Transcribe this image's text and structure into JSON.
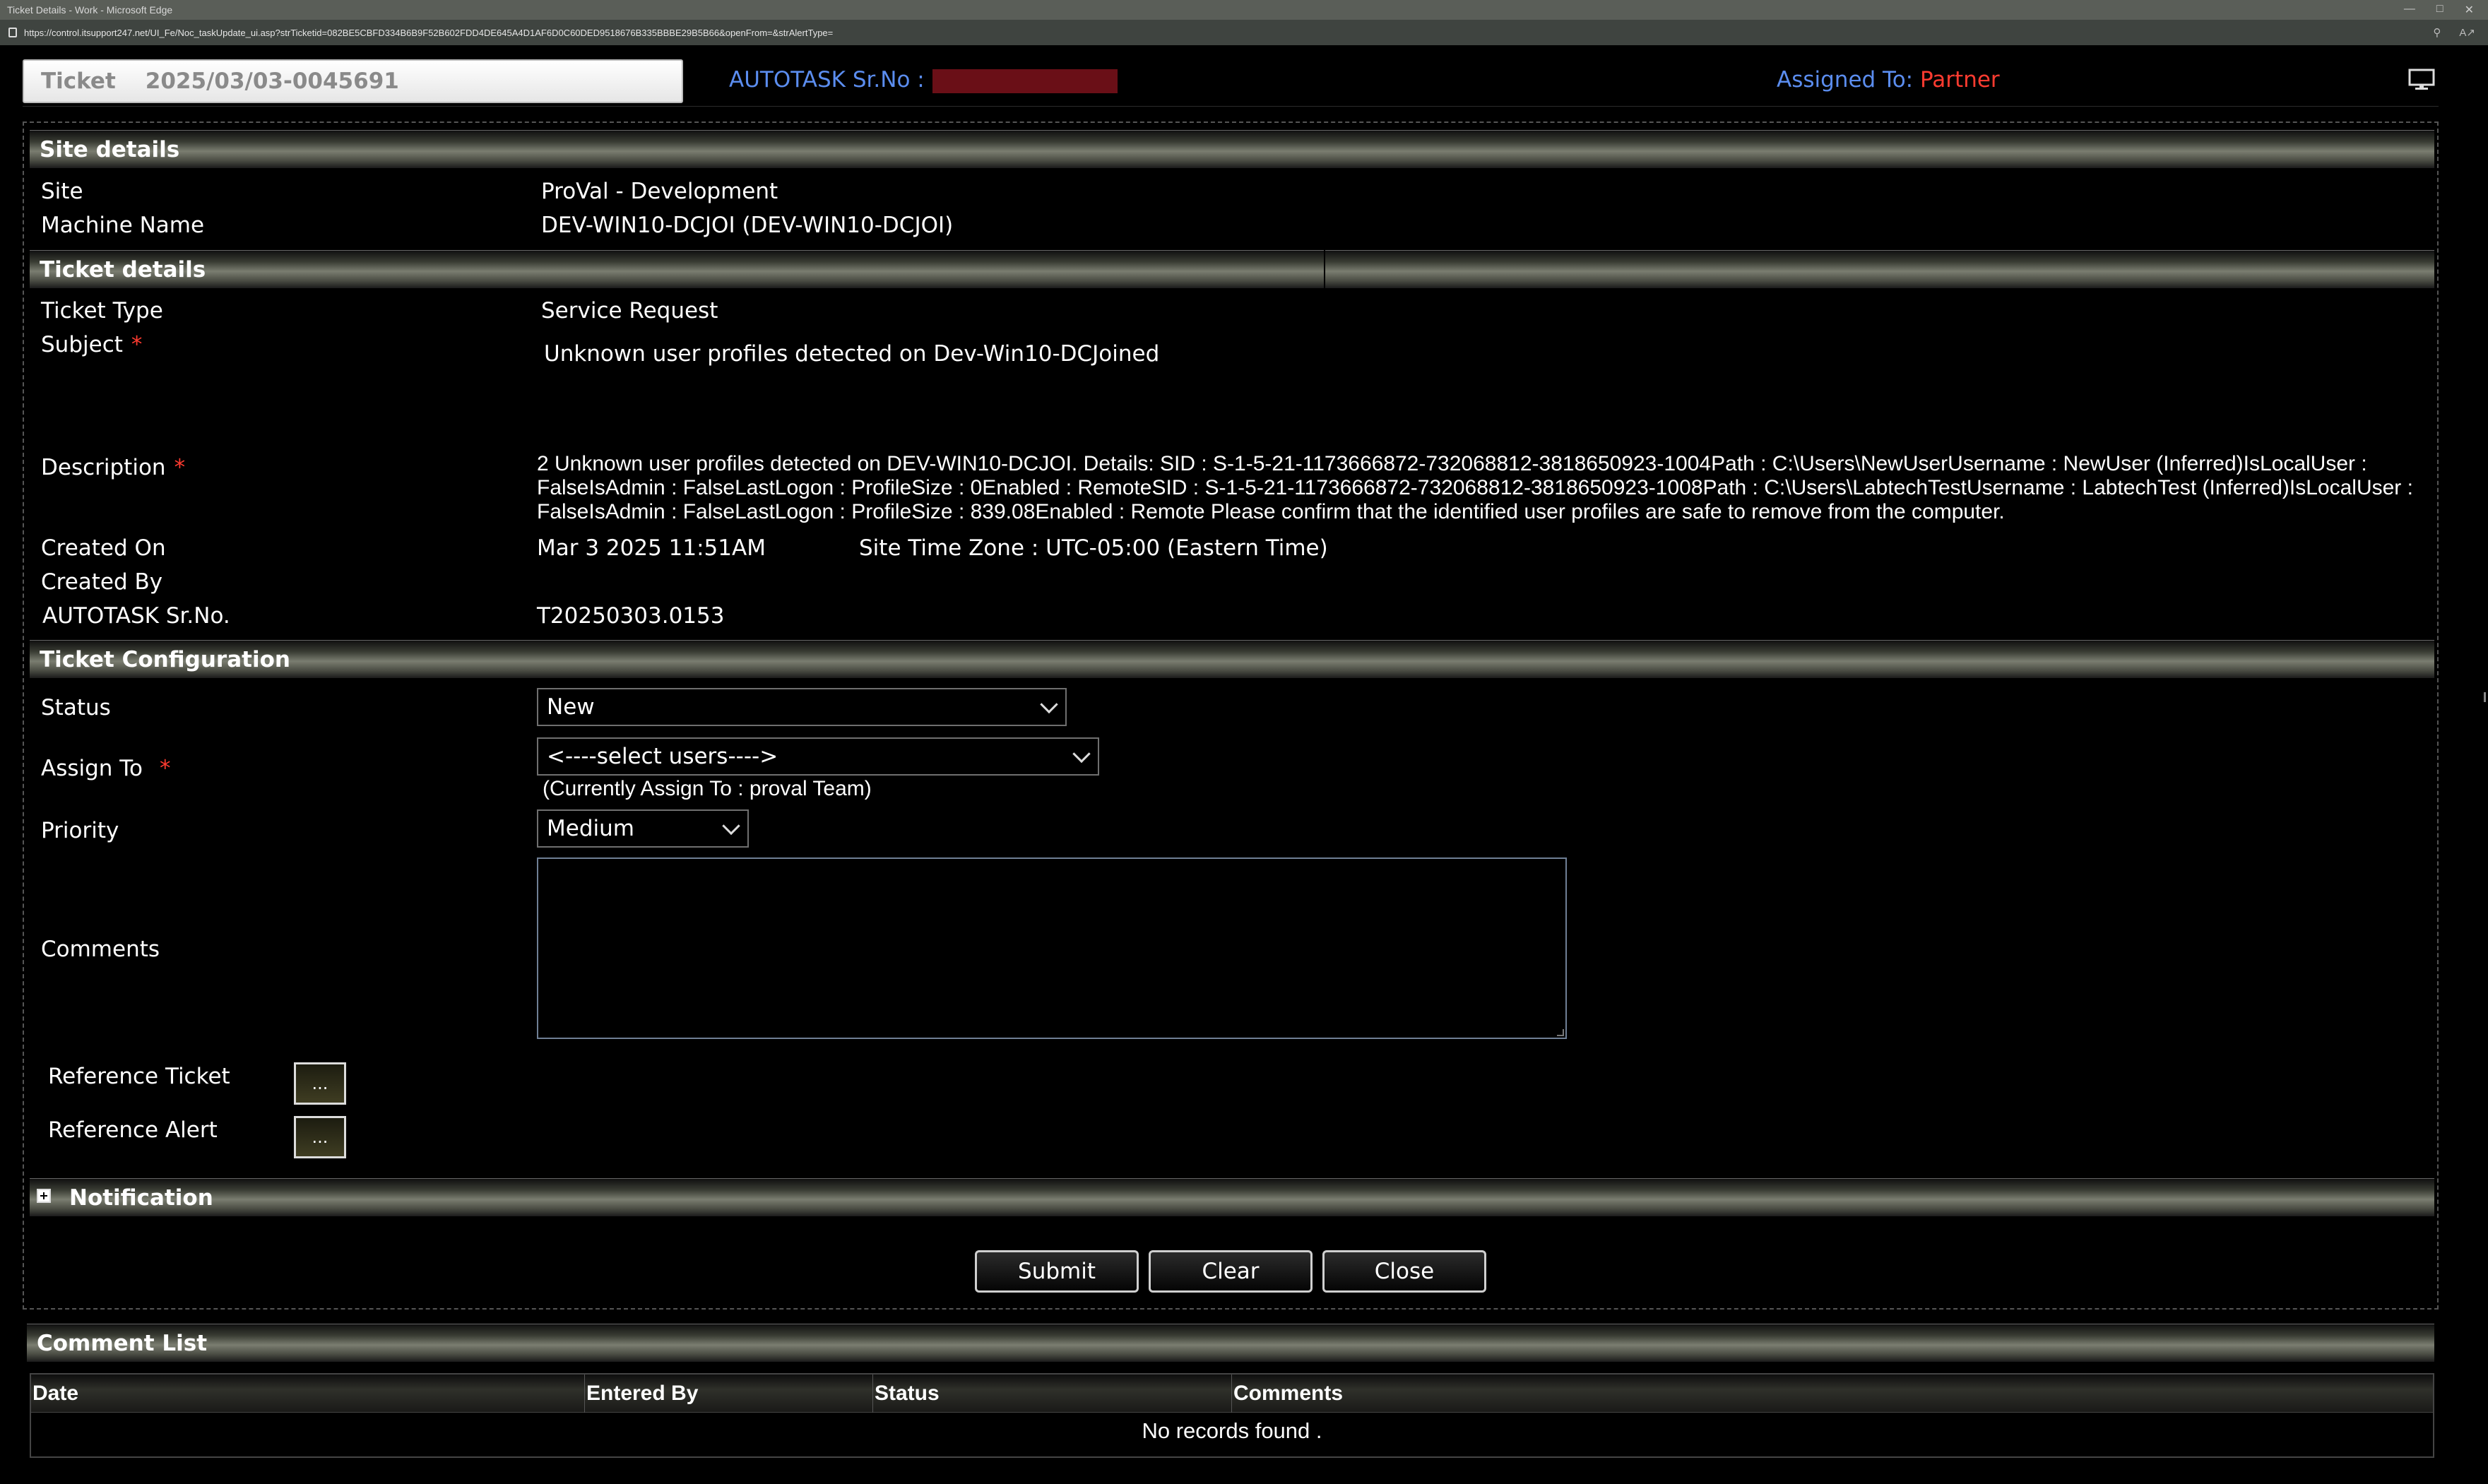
{
  "browser": {
    "window_title": "Ticket Details - Work - Microsoft Edge",
    "url": "https://control.itsupport247.net/UI_Fe/Noc_taskUpdate_ui.asp?strTicketid=082BE5CBFD334B6B9F52B602FDD4DE645A4D1AF6D0C60DED9518676B335BBBE29B5B66&openFrom=&strAlertType="
  },
  "header": {
    "ticket_label": "Ticket",
    "ticket_number": "2025/03/03-0045691",
    "autotask_label": "AUTOTASK Sr.No :",
    "assigned_label": "Assigned To:",
    "assigned_value": "Partner"
  },
  "site_details": {
    "title": "Site details",
    "site_label": "Site",
    "site_value": "ProVal - Development",
    "machine_label": "Machine Name",
    "machine_value": "DEV-WIN10-DCJOI (DEV-WIN10-DCJOI)"
  },
  "ticket_details": {
    "title": "Ticket details",
    "type_label": "Ticket Type",
    "type_value": "Service Request",
    "subject_label": "Subject",
    "subject_value": "Unknown user profiles detected on Dev-Win10-DCJoined",
    "description_label": "Description",
    "description_value": "2 Unknown user profiles detected on DEV-WIN10-DCJOI. Details: SID : S-1-5-21-1173666872-732068812-3818650923-1004Path : C:\\Users\\NewUserUsername : NewUser (Inferred)IsLocalUser : FalseIsAdmin : FalseLastLogon : ProfileSize : 0Enabled : RemoteSID : S-1-5-21-1173666872-732068812-3818650923-1008Path : C:\\Users\\LabtechTestUsername : LabtechTest (Inferred)IsLocalUser : FalseIsAdmin : FalseLastLogon : ProfileSize : 839.08Enabled : Remote Please confirm that the identified user profiles are safe to remove from the computer.",
    "created_on_label": "Created On",
    "created_on_value": "Mar 3 2025 11:51AM",
    "timezone_label": "Site Time Zone :",
    "timezone_value": "UTC-05:00 (Eastern Time)",
    "created_by_label": "Created By",
    "autotask_label": "AUTOTASK Sr.No.",
    "autotask_value": "T20250303.0153",
    "required_mark": "*"
  },
  "config": {
    "title": "Ticket Configuration",
    "status_label": "Status",
    "status_value": "New",
    "assign_label": "Assign To",
    "assign_value": "<----select users---->",
    "assign_note": "(Currently Assign To : proval Team)",
    "priority_label": "Priority",
    "priority_value": "Medium",
    "comments_label": "Comments",
    "comments_value": "",
    "ref_ticket_label": "Reference Ticket",
    "ref_alert_label": "Reference Alert",
    "ellipsis": "..."
  },
  "notification": {
    "title": "Notification"
  },
  "actions": {
    "submit": "Submit",
    "clear": "Clear",
    "close": "Close"
  },
  "comment_list": {
    "title": "Comment List",
    "columns": [
      "Date",
      "Entered By",
      "Status",
      "Comments"
    ],
    "empty_text": "No records found ."
  },
  "colors": {
    "link_blue": "#5b8def",
    "accent_red": "#ff3b30",
    "background": "#000000"
  }
}
